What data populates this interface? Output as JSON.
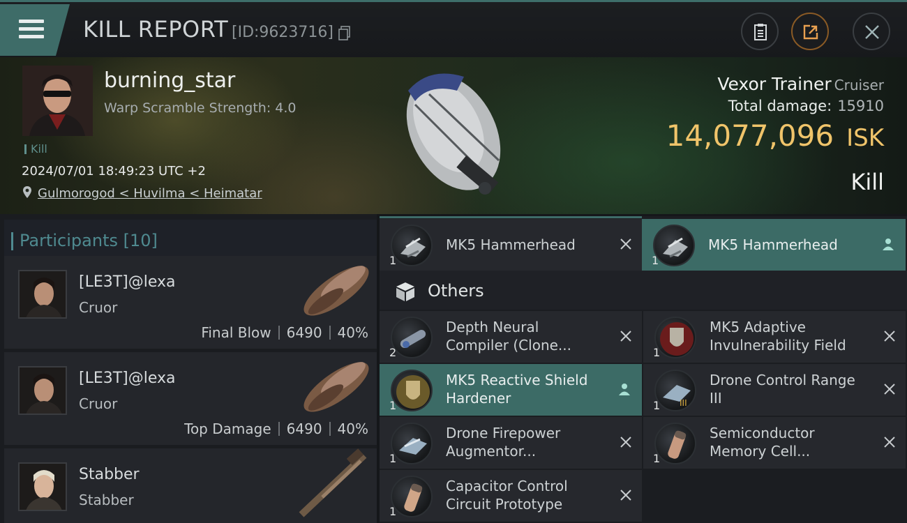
{
  "header": {
    "title": "KILL REPORT",
    "report_id": "[ID:9623716]"
  },
  "victim": {
    "pilot_name": "burning_star",
    "warp_scramble": "Warp Scramble Strength: 4.0",
    "tag": "Kill",
    "datetime": "2024/07/01 18:49:23 UTC +2",
    "location": "Gulmorogod < Huvilma < Heimatar",
    "ship_name": "Vexor Trainer",
    "ship_class": "Cruiser",
    "damage_label": "Total damage:",
    "damage_value": "15910",
    "isk_value": "14,077,096",
    "isk_unit": "ISK",
    "result": "Kill"
  },
  "participants": {
    "title": "Participants [10]",
    "rows": [
      {
        "name": "[LE3T]@lexa",
        "ship": "Cruor",
        "label": "Final Blow",
        "damage": "6490",
        "percent": "40%"
      },
      {
        "name": "[LE3T]@lexa",
        "ship": "Cruor",
        "label": "Top Damage",
        "damage": "6490",
        "percent": "40%"
      },
      {
        "name": "Stabber",
        "ship": "Stabber"
      }
    ]
  },
  "items": {
    "drones": [
      {
        "name": "MK5  Hammerhead",
        "qty": "1",
        "state": "destroyed"
      },
      {
        "name": "MK5  Hammerhead",
        "qty": "1",
        "state": "dropped"
      }
    ],
    "others_label": "Others",
    "others": [
      {
        "name_line1": "Depth Neural",
        "name_line2": "Compiler (Clone...",
        "qty": "2",
        "state": "destroyed"
      },
      {
        "name_line1": "MK5 Adaptive",
        "name_line2": "Invulnerability Field",
        "qty": "1",
        "state": "destroyed"
      },
      {
        "name_line1": "MK5 Reactive Shield",
        "name_line2": "Hardener",
        "qty": "1",
        "state": "dropped"
      },
      {
        "name_line1": "Drone Control Range",
        "name_line2": "III",
        "qty": "1",
        "state": "destroyed"
      },
      {
        "name_line1": "Drone Firepower",
        "name_line2": "Augmentor...",
        "qty": "1",
        "state": "destroyed"
      },
      {
        "name_line1": "Semiconductor",
        "name_line2": "Memory Cell...",
        "qty": "1",
        "state": "destroyed"
      },
      {
        "name_line1": "Capacitor Control",
        "name_line2": "Circuit Prototype",
        "qty": "1",
        "state": "destroyed"
      }
    ]
  },
  "colors": {
    "accent_teal": "#3e6c68",
    "isk_gold": "#f0c46a",
    "participants_title": "#4f8a90"
  }
}
